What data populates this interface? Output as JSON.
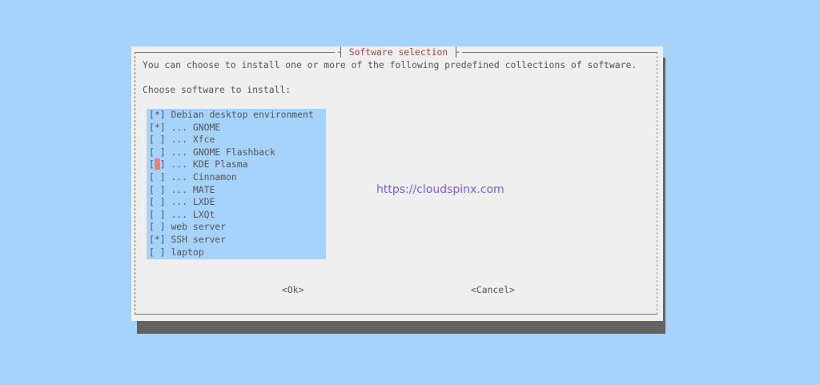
{
  "dialog": {
    "title": "Software selection",
    "intro": "You can choose to install one or more of the following predefined collections of software.",
    "prompt": "Choose software to install:",
    "items": [
      {
        "mark": "[*]",
        "label": "Debian desktop environment",
        "checked": true
      },
      {
        "mark": "[*]",
        "label": "... GNOME",
        "checked": true
      },
      {
        "mark": "[ ]",
        "label": "... Xfce",
        "checked": false
      },
      {
        "mark": "[ ]",
        "label": "... GNOME Flashback",
        "checked": false
      },
      {
        "mark": "[ ]",
        "label": "... KDE Plasma",
        "checked": false,
        "cursor": true
      },
      {
        "mark": "[ ]",
        "label": "... Cinnamon",
        "checked": false
      },
      {
        "mark": "[ ]",
        "label": "... MATE",
        "checked": false
      },
      {
        "mark": "[ ]",
        "label": "... LXDE",
        "checked": false
      },
      {
        "mark": "[ ]",
        "label": "... LXQt",
        "checked": false
      },
      {
        "mark": "[ ]",
        "label": "web server",
        "checked": false
      },
      {
        "mark": "[*]",
        "label": "SSH server",
        "checked": true
      },
      {
        "mark": "[ ]",
        "label": "laptop",
        "checked": false
      }
    ],
    "ok_label": "<Ok>",
    "cancel_label": "<Cancel>"
  },
  "watermark": "https://cloudspinx.com",
  "colors": {
    "background": "#a6d3fb",
    "dialog": "#efefef",
    "title": "#b0413e",
    "cursor": "#f07c74"
  }
}
